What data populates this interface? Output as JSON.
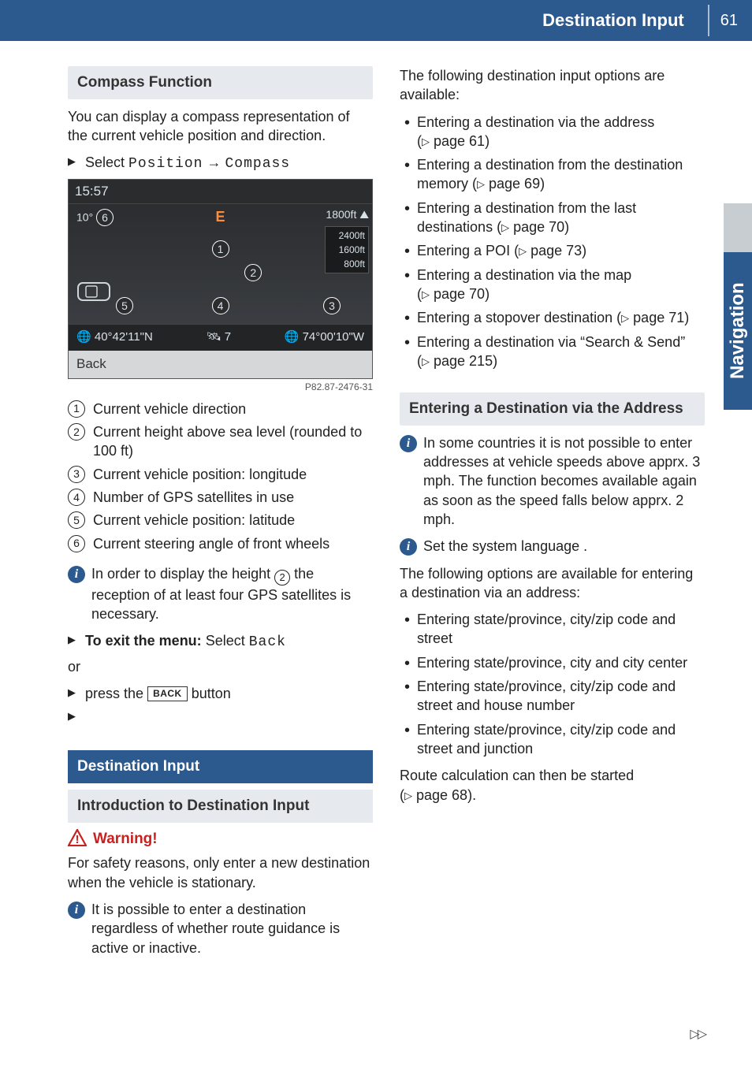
{
  "header": {
    "title": "Destination Input",
    "page": "61"
  },
  "side_tab": "Navigation",
  "col1": {
    "compass_heading": "Compass Function",
    "compass_intro": "You can display a compass representation of the current vehicle position and direction.",
    "select_prefix": "Select",
    "select_position": "Position",
    "select_compass": "Compass",
    "screenshot": {
      "time": "15:57",
      "steering": "10°",
      "dir_letter": "E",
      "alt_top": "1800ft",
      "alt_scale": [
        "2400ft",
        "1600ft",
        "800ft"
      ],
      "lat": "40°42'11\"N",
      "sat": "7",
      "lon": "74°00'10\"W",
      "back": "Back",
      "img_id": "P82.87-2476-31"
    },
    "legend": [
      "Current vehicle direction",
      "Current height above sea level (rounded to 100 ft)",
      "Current vehicle position: longitude",
      "Number of GPS satellites in use",
      "Current vehicle position: latitude",
      "Current steering angle of front wheels"
    ],
    "info_height_pre": "In order to display the height ",
    "info_height_post": " the reception of at least four GPS satellites is necessary.",
    "exit_bold": "To exit the menu:",
    "exit_select": "Select",
    "exit_back": "Back",
    "or": "or",
    "press_the": "press the",
    "back_key": "BACK",
    "button_word": "button",
    "dest_input_heading": "Destination Input",
    "intro_heading": "Introduction to Destination Input",
    "warning_label": "Warning!",
    "warning_text": "For safety reasons, only enter a new destination when the vehicle is stationary.",
    "info_dest": "It is possible to enter a destination regardless of whether route guidance is active or inactive."
  },
  "col2": {
    "intro": "The following destination input options are available:",
    "opts": [
      {
        "text": "Entering a destination via the address",
        "page": "61"
      },
      {
        "text": "Entering a destination from the destination memory",
        "page": "69"
      },
      {
        "text": "Entering a destination from the last destinations",
        "page": "70"
      },
      {
        "text": "Entering a POI",
        "page": "73"
      },
      {
        "text": "Entering a destination via the map",
        "page": "70"
      },
      {
        "text": "Entering a stopover destination",
        "page": "71"
      },
      {
        "text": "Entering a destination via “Search & Send”",
        "page": "215"
      }
    ],
    "addr_heading": "Entering a Destination via the Address",
    "info_speed": "In some countries it is not possible to enter addresses at vehicle speeds above apprx. 3 mph. The function becomes available again as soon as the speed falls below apprx. 2 mph.",
    "info_lang": "Set the system language .",
    "addr_intro": "The following options are available for entering a destination via an address:",
    "addr_opts": [
      "Entering state/province, city/zip code and street",
      "Entering state/province, city and city center",
      "Entering state/province, city/zip code and street and house number",
      "Entering state/province, city/zip code and street and junction"
    ],
    "route_calc": "Route calculation can then be started",
    "route_calc_page": "68"
  }
}
